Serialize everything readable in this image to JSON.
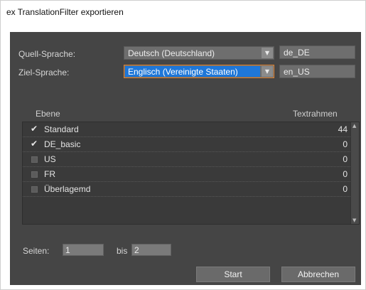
{
  "window": {
    "title": "ex TranslationFilter exportieren"
  },
  "source": {
    "label": "Quell-Sprache:",
    "value": "Deutsch (Deutschland)",
    "code": "de_DE"
  },
  "target": {
    "label": "Ziel-Sprache:",
    "value": "Englisch (Vereinigte Staaten)",
    "code": "en_US"
  },
  "table": {
    "headers": {
      "layer": "Ebene",
      "frames": "Textrahmen"
    },
    "rows": [
      {
        "name": "Standard",
        "count": "44",
        "checked": true
      },
      {
        "name": "DE_basic",
        "count": "0",
        "checked": true
      },
      {
        "name": "US",
        "count": "0",
        "checked": false
      },
      {
        "name": "FR",
        "count": "0",
        "checked": false
      },
      {
        "name": "Überlagemd",
        "count": "0",
        "checked": false
      }
    ]
  },
  "pages": {
    "label": "Seiten:",
    "from": "1",
    "to_label": "bis",
    "to": "2"
  },
  "buttons": {
    "start": "Start",
    "cancel": "Abbrechen"
  },
  "icons": {
    "check": "checkmark-icon",
    "dropdown": "chevron-down-icon"
  },
  "colors": {
    "panel": "#454545",
    "highlight": "#1f77d8",
    "focus_border": "#e0822f"
  }
}
